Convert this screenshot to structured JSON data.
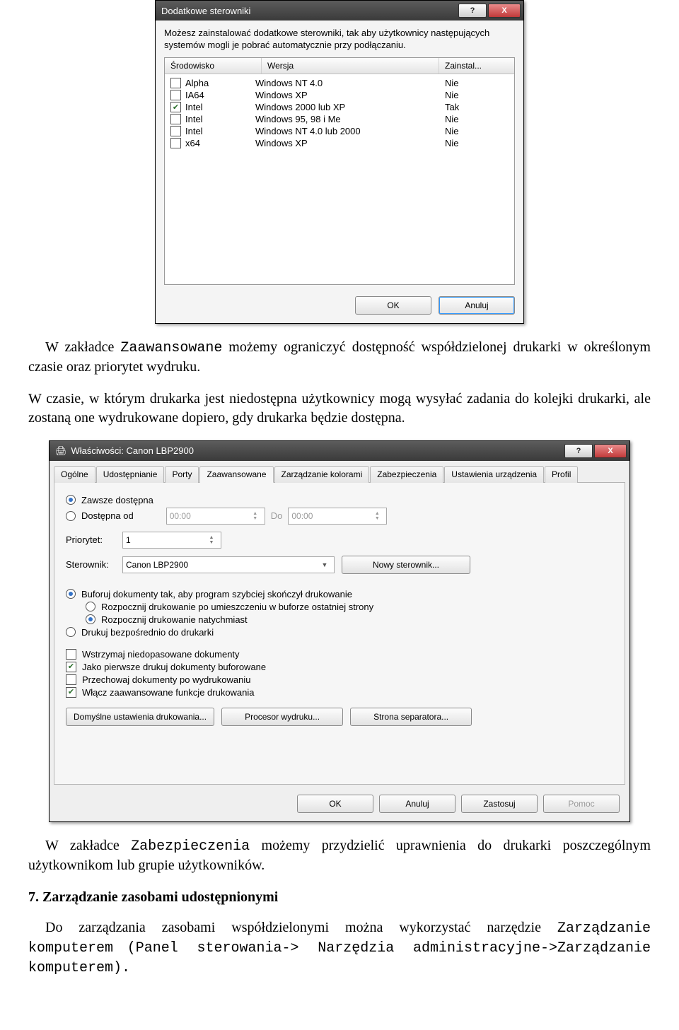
{
  "dlg1": {
    "title": "Dodatkowe sterowniki",
    "help_btn": "?",
    "close_btn": "X",
    "description": "Możesz zainstalować dodatkowe sterowniki, tak aby użytkownicy następujących systemów mogli je pobrać automatycznie przy podłączaniu.",
    "headers": {
      "env": "Środowisko",
      "ver": "Wersja",
      "inst": "Zainstal..."
    },
    "rows": [
      {
        "checked": false,
        "env": "Alpha",
        "ver": "Windows NT 4.0",
        "inst": "Nie"
      },
      {
        "checked": false,
        "env": "IA64",
        "ver": "Windows XP",
        "inst": "Nie"
      },
      {
        "checked": true,
        "env": "Intel",
        "ver": "Windows 2000 lub XP",
        "inst": "Tak"
      },
      {
        "checked": false,
        "env": "Intel",
        "ver": "Windows 95, 98 i Me",
        "inst": "Nie"
      },
      {
        "checked": false,
        "env": "Intel",
        "ver": "Windows NT 4.0 lub 2000",
        "inst": "Nie"
      },
      {
        "checked": false,
        "env": "x64",
        "ver": "Windows XP",
        "inst": "Nie"
      }
    ],
    "ok": "OK",
    "cancel": "Anuluj"
  },
  "para1": {
    "p1a": "W zakładce ",
    "p1b": "Zaawansowane",
    "p1c": " możemy ograniczyć dostępność współdzielonej drukarki w określonym czasie oraz priorytet wydruku.",
    "p2": "W czasie, w którym drukarka jest niedostępna użytkownicy mogą wysyłać zadania do kolejki drukarki, ale zostaną one wydrukowane dopiero, gdy drukarka będzie dostępna."
  },
  "dlg2": {
    "title": "Właściwości: Canon LBP2900",
    "help_btn": "?",
    "close_btn": "X",
    "tabs": [
      "Ogólne",
      "Udostępnianie",
      "Porty",
      "Zaawansowane",
      "Zarządzanie kolorami",
      "Zabezpieczenia",
      "Ustawienia urządzenia",
      "Profil"
    ],
    "active_tab": 3,
    "avail": {
      "always": "Zawsze dostępna",
      "from": "Dostępna od",
      "time_from": "00:00",
      "to_lbl": "Do",
      "time_to": "00:00",
      "selected": "always"
    },
    "priority_lbl": "Priorytet:",
    "priority_val": "1",
    "driver_lbl": "Sterownik:",
    "driver_val": "Canon LBP2900",
    "new_driver_btn": "Nowy sterownik...",
    "spool": {
      "spool_opt": "Buforuj dokumenty tak, aby program szybciej skończył drukowanie",
      "after_last": "Rozpocznij drukowanie po umieszczeniu w buforze ostatniej strony",
      "immediate": "Rozpocznij drukowanie natychmiast",
      "direct": "Drukuj bezpośrednio do drukarki",
      "spool_selected": true,
      "sub_selected": "immediate"
    },
    "checks": {
      "hold": {
        "label": "Wstrzymaj niedopasowane dokumenty",
        "on": false
      },
      "first_spooled": {
        "label": "Jako pierwsze drukuj dokumenty buforowane",
        "on": true
      },
      "keep": {
        "label": "Przechowaj dokumenty po wydrukowaniu",
        "on": false
      },
      "adv_features": {
        "label": "Włącz zaawansowane funkcje drukowania",
        "on": true
      }
    },
    "btns": {
      "defaults": "Domyślne ustawienia drukowania...",
      "processor": "Procesor wydruku...",
      "sep": "Strona separatora..."
    },
    "footer": {
      "ok": "OK",
      "cancel": "Anuluj",
      "apply": "Zastosuj",
      "help": "Pomoc"
    }
  },
  "para2": {
    "a": "W zakładce ",
    "b": "Zabezpieczenia",
    "c": " możemy przydzielić uprawnienia do drukarki poszczególnym użytkownikom lub grupie użytkowników."
  },
  "sec7": {
    "heading": "7. Zarządzanie zasobami udostępnionymi",
    "a": "Do zarządzania zasobami współdzielonymi można wykorzystać narzędzie ",
    "b": "Zarządzanie komputerem",
    "c": "(Panel sterowania-> Narzędzia administracyjne->Zarządzanie komputerem).",
    "space": " "
  }
}
